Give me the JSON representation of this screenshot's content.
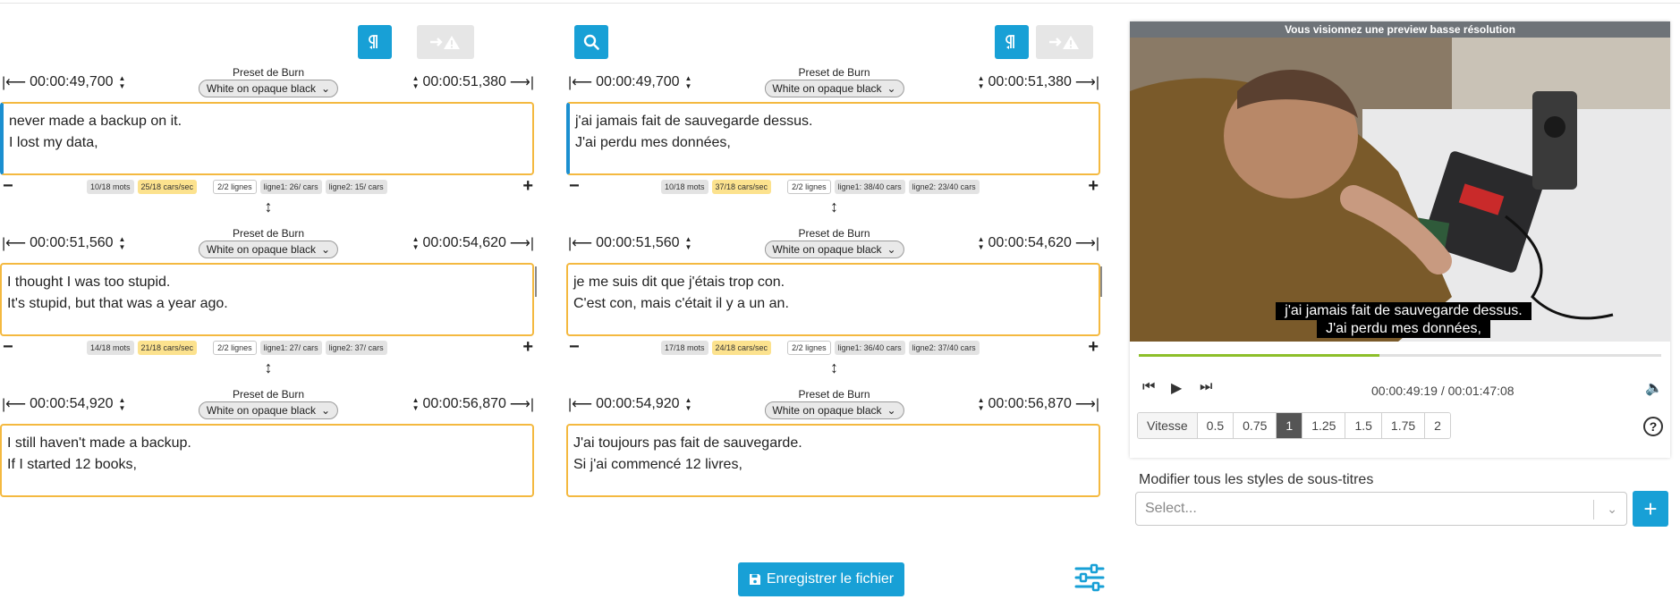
{
  "editor": {
    "preset_label": "Preset de Burn",
    "left": {
      "blocks": [
        {
          "start": "00:00:49,700",
          "end": "00:00:51,380",
          "preset": "White on opaque black",
          "lines": [
            "never made a backup on it.",
            "I lost my data,"
          ],
          "words": "10/18 mots",
          "cps": "25/18 cars/sec",
          "lines_count": "2/2 lignes",
          "line1": "ligne1: 26/ cars",
          "line2": "ligne2: 15/ cars"
        },
        {
          "start": "00:00:51,560",
          "end": "00:00:54,620",
          "preset": "White on opaque black",
          "lines": [
            "I thought I was too stupid.",
            "It's stupid, but that was a year ago."
          ],
          "words": "14/18 mots",
          "cps": "21/18 cars/sec",
          "lines_count": "2/2 lignes",
          "line1": "ligne1: 27/ cars",
          "line2": "ligne2: 37/ cars"
        },
        {
          "start": "00:00:54,920",
          "end": "00:00:56,870",
          "preset": "White on opaque black",
          "lines": [
            "I still haven't made a backup.",
            "If I started 12 books,"
          ]
        }
      ]
    },
    "right": {
      "blocks": [
        {
          "start": "00:00:49,700",
          "end": "00:00:51,380",
          "preset": "White on opaque black",
          "lines": [
            "j'ai jamais fait de sauvegarde dessus.",
            "J'ai perdu mes données,"
          ],
          "words": "10/18 mots",
          "cps": "37/18 cars/sec",
          "lines_count": "2/2 lignes",
          "line1": "ligne1: 38/40 cars",
          "line2": "ligne2: 23/40 cars"
        },
        {
          "start": "00:00:51,560",
          "end": "00:00:54,620",
          "preset": "White on opaque black",
          "lines": [
            "je me suis dit que j'étais trop con.",
            "C'est con, mais c'était il y a un an."
          ],
          "words": "17/18 mots",
          "cps": "24/18 cars/sec",
          "lines_count": "2/2 lignes",
          "line1": "ligne1: 36/40 cars",
          "line2": "ligne2: 37/40 cars"
        },
        {
          "start": "00:00:54,920",
          "end": "00:00:56,870",
          "preset": "White on opaque black",
          "lines": [
            "J'ai toujours pas fait de sauvegarde.",
            "Si j'ai commencé 12 livres,"
          ]
        }
      ]
    },
    "save_label": "Enregistrer le fichier"
  },
  "player": {
    "banner": "Vous visionnez une preview basse résolution",
    "subtitle_lines": [
      "j'ai jamais fait de sauvegarde dessus.",
      "J'ai perdu mes données,"
    ],
    "time": "00:00:49:19 / 00:01:47:08",
    "progress": 0.46,
    "speed_label": "Vitesse",
    "speeds": [
      "0.5",
      "0.75",
      "1",
      "1.25",
      "1.5",
      "1.75",
      "2"
    ],
    "speed_selected": "1",
    "help": "?"
  },
  "styles": {
    "label": "Modifier tous les styles de sous-titres",
    "placeholder": "Select...",
    "add": "+"
  },
  "colors": {
    "accent": "#18a0d6",
    "border_warn": "#f4b940",
    "chip_warn": "#fce28e",
    "progress": "#8dbf2a"
  }
}
